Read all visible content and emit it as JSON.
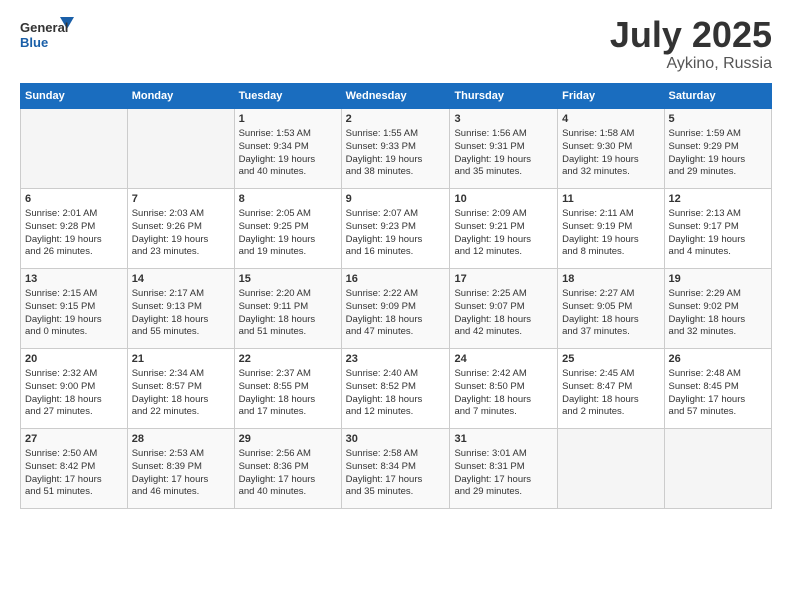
{
  "header": {
    "logo_line1": "General",
    "logo_line2": "Blue",
    "title": "July 2025",
    "location": "Aykino, Russia"
  },
  "columns": [
    "Sunday",
    "Monday",
    "Tuesday",
    "Wednesday",
    "Thursday",
    "Friday",
    "Saturday"
  ],
  "weeks": [
    [
      {
        "day": "",
        "info": ""
      },
      {
        "day": "",
        "info": ""
      },
      {
        "day": "1",
        "info": "Sunrise: 1:53 AM\nSunset: 9:34 PM\nDaylight: 19 hours\nand 40 minutes."
      },
      {
        "day": "2",
        "info": "Sunrise: 1:55 AM\nSunset: 9:33 PM\nDaylight: 19 hours\nand 38 minutes."
      },
      {
        "day": "3",
        "info": "Sunrise: 1:56 AM\nSunset: 9:31 PM\nDaylight: 19 hours\nand 35 minutes."
      },
      {
        "day": "4",
        "info": "Sunrise: 1:58 AM\nSunset: 9:30 PM\nDaylight: 19 hours\nand 32 minutes."
      },
      {
        "day": "5",
        "info": "Sunrise: 1:59 AM\nSunset: 9:29 PM\nDaylight: 19 hours\nand 29 minutes."
      }
    ],
    [
      {
        "day": "6",
        "info": "Sunrise: 2:01 AM\nSunset: 9:28 PM\nDaylight: 19 hours\nand 26 minutes."
      },
      {
        "day": "7",
        "info": "Sunrise: 2:03 AM\nSunset: 9:26 PM\nDaylight: 19 hours\nand 23 minutes."
      },
      {
        "day": "8",
        "info": "Sunrise: 2:05 AM\nSunset: 9:25 PM\nDaylight: 19 hours\nand 19 minutes."
      },
      {
        "day": "9",
        "info": "Sunrise: 2:07 AM\nSunset: 9:23 PM\nDaylight: 19 hours\nand 16 minutes."
      },
      {
        "day": "10",
        "info": "Sunrise: 2:09 AM\nSunset: 9:21 PM\nDaylight: 19 hours\nand 12 minutes."
      },
      {
        "day": "11",
        "info": "Sunrise: 2:11 AM\nSunset: 9:19 PM\nDaylight: 19 hours\nand 8 minutes."
      },
      {
        "day": "12",
        "info": "Sunrise: 2:13 AM\nSunset: 9:17 PM\nDaylight: 19 hours\nand 4 minutes."
      }
    ],
    [
      {
        "day": "13",
        "info": "Sunrise: 2:15 AM\nSunset: 9:15 PM\nDaylight: 19 hours\nand 0 minutes."
      },
      {
        "day": "14",
        "info": "Sunrise: 2:17 AM\nSunset: 9:13 PM\nDaylight: 18 hours\nand 55 minutes."
      },
      {
        "day": "15",
        "info": "Sunrise: 2:20 AM\nSunset: 9:11 PM\nDaylight: 18 hours\nand 51 minutes."
      },
      {
        "day": "16",
        "info": "Sunrise: 2:22 AM\nSunset: 9:09 PM\nDaylight: 18 hours\nand 47 minutes."
      },
      {
        "day": "17",
        "info": "Sunrise: 2:25 AM\nSunset: 9:07 PM\nDaylight: 18 hours\nand 42 minutes."
      },
      {
        "day": "18",
        "info": "Sunrise: 2:27 AM\nSunset: 9:05 PM\nDaylight: 18 hours\nand 37 minutes."
      },
      {
        "day": "19",
        "info": "Sunrise: 2:29 AM\nSunset: 9:02 PM\nDaylight: 18 hours\nand 32 minutes."
      }
    ],
    [
      {
        "day": "20",
        "info": "Sunrise: 2:32 AM\nSunset: 9:00 PM\nDaylight: 18 hours\nand 27 minutes."
      },
      {
        "day": "21",
        "info": "Sunrise: 2:34 AM\nSunset: 8:57 PM\nDaylight: 18 hours\nand 22 minutes."
      },
      {
        "day": "22",
        "info": "Sunrise: 2:37 AM\nSunset: 8:55 PM\nDaylight: 18 hours\nand 17 minutes."
      },
      {
        "day": "23",
        "info": "Sunrise: 2:40 AM\nSunset: 8:52 PM\nDaylight: 18 hours\nand 12 minutes."
      },
      {
        "day": "24",
        "info": "Sunrise: 2:42 AM\nSunset: 8:50 PM\nDaylight: 18 hours\nand 7 minutes."
      },
      {
        "day": "25",
        "info": "Sunrise: 2:45 AM\nSunset: 8:47 PM\nDaylight: 18 hours\nand 2 minutes."
      },
      {
        "day": "26",
        "info": "Sunrise: 2:48 AM\nSunset: 8:45 PM\nDaylight: 17 hours\nand 57 minutes."
      }
    ],
    [
      {
        "day": "27",
        "info": "Sunrise: 2:50 AM\nSunset: 8:42 PM\nDaylight: 17 hours\nand 51 minutes."
      },
      {
        "day": "28",
        "info": "Sunrise: 2:53 AM\nSunset: 8:39 PM\nDaylight: 17 hours\nand 46 minutes."
      },
      {
        "day": "29",
        "info": "Sunrise: 2:56 AM\nSunset: 8:36 PM\nDaylight: 17 hours\nand 40 minutes."
      },
      {
        "day": "30",
        "info": "Sunrise: 2:58 AM\nSunset: 8:34 PM\nDaylight: 17 hours\nand 35 minutes."
      },
      {
        "day": "31",
        "info": "Sunrise: 3:01 AM\nSunset: 8:31 PM\nDaylight: 17 hours\nand 29 minutes."
      },
      {
        "day": "",
        "info": ""
      },
      {
        "day": "",
        "info": ""
      }
    ]
  ]
}
